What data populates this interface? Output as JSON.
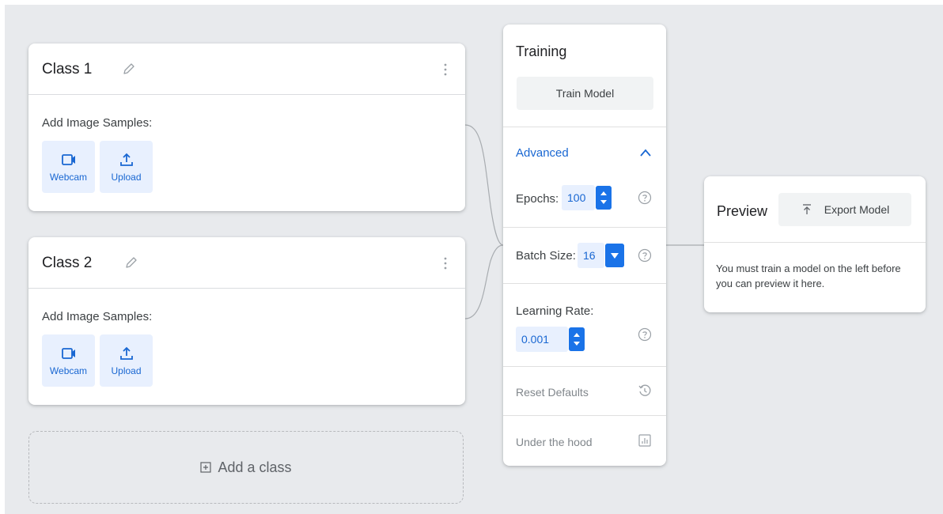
{
  "classes": [
    {
      "title": "Class 1",
      "samples_label": "Add Image Samples:",
      "webcam_label": "Webcam",
      "upload_label": "Upload"
    },
    {
      "title": "Class 2",
      "samples_label": "Add Image Samples:",
      "webcam_label": "Webcam",
      "upload_label": "Upload"
    }
  ],
  "add_class_label": "Add a class",
  "training": {
    "title": "Training",
    "train_button": "Train Model",
    "advanced_label": "Advanced",
    "epochs_label": "Epochs:",
    "epochs_value": "100",
    "batch_size_label": "Batch Size:",
    "batch_size_value": "16",
    "learning_rate_label": "Learning Rate:",
    "learning_rate_value": "0.001",
    "reset_defaults": "Reset Defaults",
    "under_the_hood": "Under the hood"
  },
  "preview": {
    "title": "Preview",
    "export_button": "Export Model",
    "message": "You must train a model on the left before you can preview it here."
  },
  "colors": {
    "accent": "#1a73e8",
    "accent_text": "#1967d2",
    "accent_bg": "#e8f0fe",
    "canvas_bg": "#e8eaed"
  },
  "icons": {
    "edit": "pencil-icon",
    "menu": "kebab-menu-icon",
    "webcam": "video-camera-icon",
    "upload": "upload-icon",
    "add": "plus-box-icon",
    "collapse": "chevron-up-icon",
    "help": "help-circle-icon",
    "reset": "history-icon",
    "under_the_hood": "bar-chart-icon",
    "export": "export-arrow-icon"
  }
}
